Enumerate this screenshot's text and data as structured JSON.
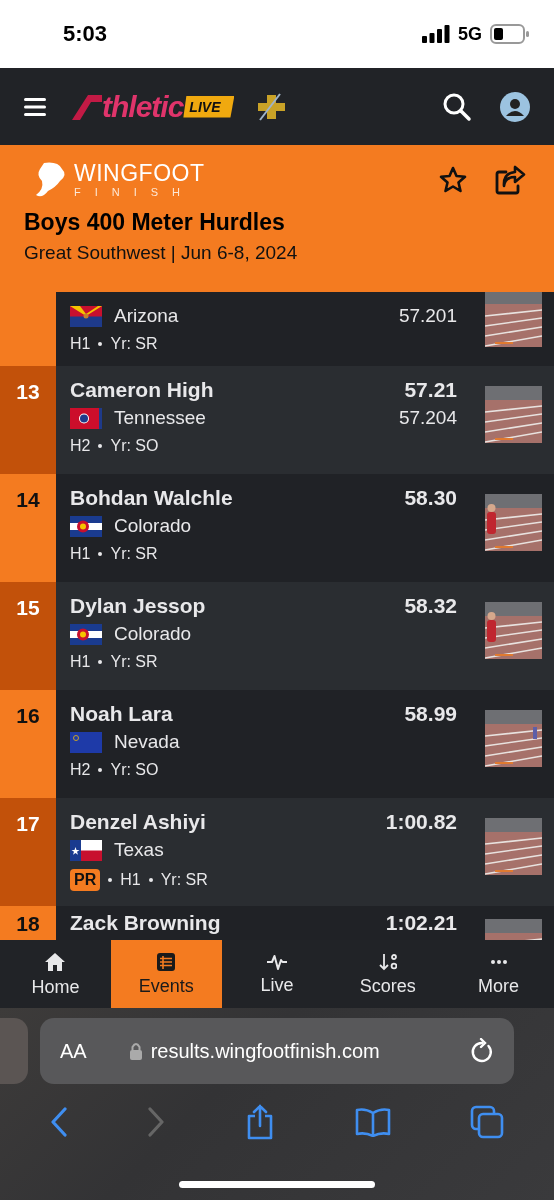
{
  "status_bar": {
    "time": "5:03",
    "network": "5G"
  },
  "nav": {
    "logo_word": "thletic",
    "logo_badge": "LIVE"
  },
  "event": {
    "brand": "WINGFOOT",
    "brand_sub": "FINISH",
    "title": "Boys 400 Meter Hurdles",
    "subtitle": "Great Southwest | Jun 6-8, 2024",
    "favorite": false
  },
  "results": [
    {
      "state": "Arizona",
      "time_detail": "57.201",
      "heat": "H1",
      "year": "Yr: SR",
      "pr": false
    },
    {
      "rank": "13",
      "name": "Cameron High",
      "state": "Tennessee",
      "time": "57.21",
      "time_detail": "57.204",
      "heat": "H2",
      "year": "Yr: SO",
      "pr": false
    },
    {
      "rank": "14",
      "name": "Bohdan Walchle",
      "state": "Colorado",
      "time": "58.30",
      "heat": "H1",
      "year": "Yr: SR",
      "pr": false
    },
    {
      "rank": "15",
      "name": "Dylan Jessop",
      "state": "Colorado",
      "time": "58.32",
      "heat": "H1",
      "year": "Yr: SR",
      "pr": false
    },
    {
      "rank": "16",
      "name": "Noah Lara",
      "state": "Nevada",
      "time": "58.99",
      "heat": "H2",
      "year": "Yr: SO",
      "pr": false
    },
    {
      "rank": "17",
      "name": "Denzel Ashiyi",
      "state": "Texas",
      "time": "1:00.82",
      "heat": "H1",
      "year": "Yr: SR",
      "pr": true,
      "pr_label": "PR"
    },
    {
      "rank": "18",
      "name": "Zack Browning",
      "time": "1:02.21"
    }
  ],
  "tabs": [
    {
      "label": "Home",
      "selected": false
    },
    {
      "label": "Events",
      "selected": true
    },
    {
      "label": "Live",
      "selected": false
    },
    {
      "label": "Scores",
      "selected": false
    },
    {
      "label": "More",
      "selected": false
    }
  ],
  "browser": {
    "text_size": "AA",
    "url": "results.wingfootfinish.com"
  }
}
